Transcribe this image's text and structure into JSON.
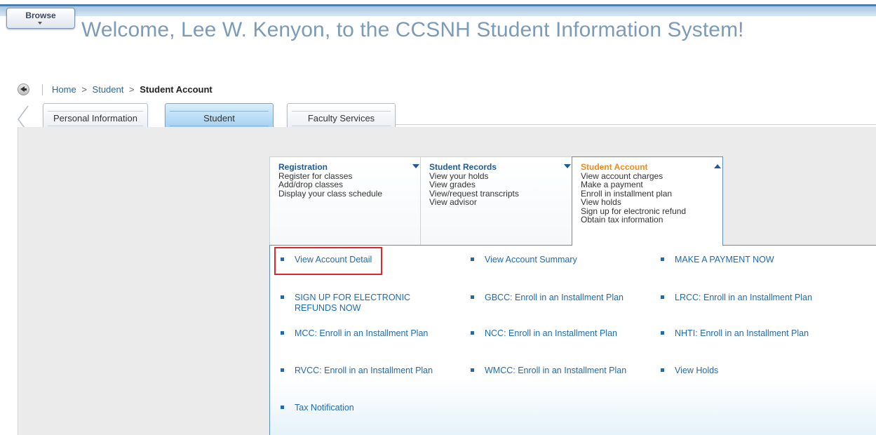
{
  "header": {
    "browse_label": "Browse",
    "welcome_text": "Welcome, Lee W. Kenyon, to the CCSNH Student Information System!"
  },
  "breadcrumb": {
    "home": "Home",
    "sep1": ">",
    "student": "Student",
    "sep2": ">",
    "current": "Student Account"
  },
  "tabs": [
    {
      "label": "Personal Information"
    },
    {
      "label": "Student"
    },
    {
      "label": "Faculty Services"
    }
  ],
  "cards": {
    "registration": {
      "title": "Registration",
      "items": [
        "Register for classes",
        "Add/drop classes",
        "Display your class schedule"
      ]
    },
    "records": {
      "title": "Student Records",
      "items": [
        "View your holds",
        "View grades",
        "View/request transcripts",
        "View advisor"
      ]
    },
    "account": {
      "title": "Student Account",
      "items": [
        "View account charges",
        "Make a payment",
        "Enroll in installment plan",
        "View holds",
        "Sign up for electronic refund",
        "Obtain tax information"
      ]
    }
  },
  "links": [
    "View Account Detail",
    "View Account Summary",
    "MAKE A PAYMENT NOW",
    "SIGN UP FOR ELECTRONIC REFUNDS NOW",
    "GBCC: Enroll in an Installment Plan",
    "LRCC: Enroll in an Installment Plan",
    "MCC: Enroll in an Installment Plan",
    "NCC: Enroll in an Installment Plan",
    "NHTI: Enroll in an Installment Plan",
    "RVCC: Enroll in an Installment Plan",
    "WMCC: Enroll in an Installment Plan",
    "View Holds",
    "Tax Notification"
  ],
  "colors": {
    "link": "#1e6bb0",
    "active_title": "#f08a1a",
    "highlight": "#e0262b"
  }
}
